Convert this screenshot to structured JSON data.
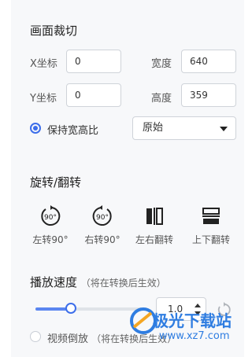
{
  "crop": {
    "title": "画面裁切",
    "x_label": "X坐标",
    "x_value": "0",
    "width_label": "宽度",
    "width_value": "640",
    "y_label": "Y坐标",
    "y_value": "0",
    "height_label": "高度",
    "height_value": "359",
    "keep_ratio_label": "保持宽高比",
    "keep_ratio_checked": true,
    "ratio_select": "原始"
  },
  "rotate": {
    "title": "旋转/翻转",
    "buttons": [
      {
        "label": "左转90°",
        "icon": "rotate-left-90-icon",
        "glyph": "90°"
      },
      {
        "label": "右转90°",
        "icon": "rotate-right-90-icon",
        "glyph": "90°"
      },
      {
        "label": "左右翻转",
        "icon": "flip-horizontal-icon"
      },
      {
        "label": "上下翻转",
        "icon": "flip-vertical-icon"
      }
    ]
  },
  "speed": {
    "title": "播放速度",
    "note": "（将在转换后生效）",
    "slider_fraction": 0.33,
    "value": "1.0",
    "reverse_label": "视频倒放",
    "reverse_note": "（将在转换后生效）",
    "reverse_checked": false
  },
  "watermark": {
    "text": "极光下载站",
    "url": "www.xz7.com"
  },
  "colors": {
    "accent": "#3d6eea",
    "panel_bg": "#f7f8fa",
    "border": "#cfd3d9"
  }
}
